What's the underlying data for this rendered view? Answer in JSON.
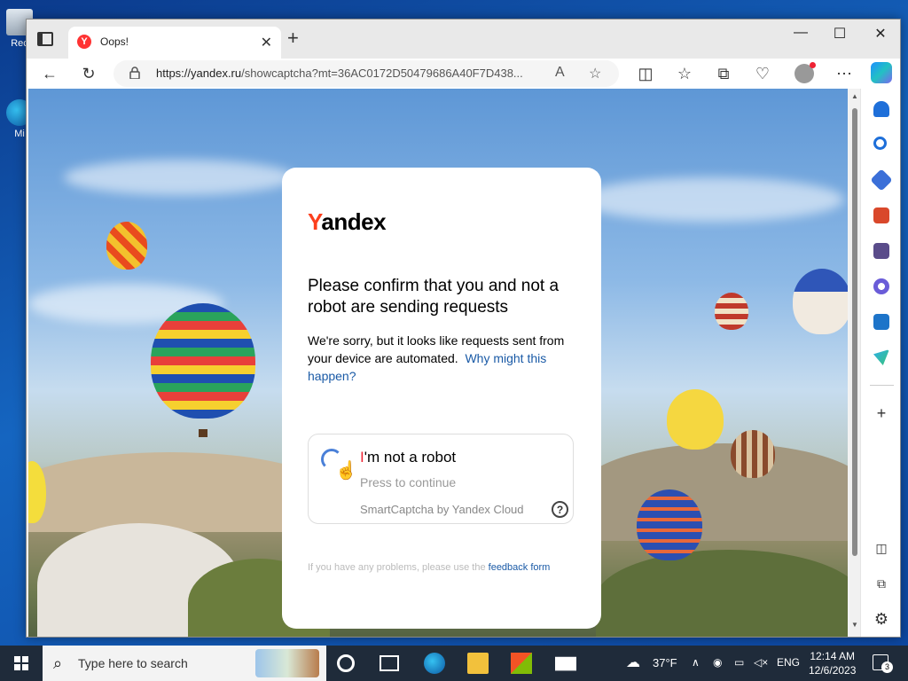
{
  "desktop": {
    "icons": [
      {
        "label": "Rec"
      },
      {
        "label": "Mi"
      }
    ]
  },
  "browser": {
    "tab_title": "Oops!",
    "url_host": "https://yandex.ru",
    "url_rest": "/showcaptcha?mt=36AC0172D50479686A40F7D438..."
  },
  "captcha": {
    "logo_y": "Y",
    "logo_rest": "andex",
    "headline": "Please confirm that you and not a robot are sending requests",
    "desc": "We're sorry, but it looks like requests sent from your device are automated.",
    "desc_link": "Why might this happen?",
    "robot_title_first": "I",
    "robot_title_rest": "'m not a robot",
    "robot_sub": "Press to continue",
    "robot_foot": "SmartCaptcha by Yandex Cloud",
    "help": "?",
    "feedback_text": "If you have any problems, please use the",
    "feedback_link": "feedback form"
  },
  "taskbar": {
    "search_placeholder": "Type here to search",
    "weather": "37°F",
    "language": "ENG",
    "time": "12:14 AM",
    "date": "12/6/2023",
    "notification_count": "3"
  }
}
